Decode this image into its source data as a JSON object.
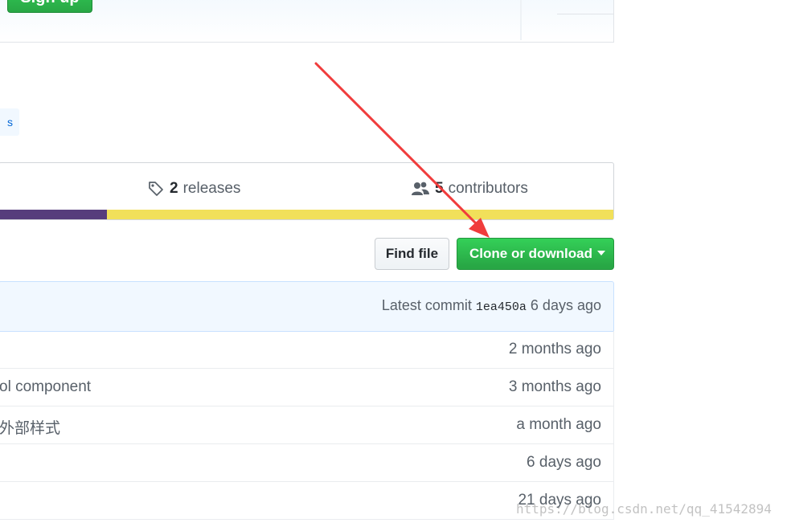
{
  "signup": {
    "button_label": "Sign up"
  },
  "topic": {
    "label": "s"
  },
  "summary": {
    "releases_count": "2",
    "releases_label": "releases",
    "contributors_count": "5",
    "contributors_label": "contributors",
    "language_bar": [
      {
        "color": "#563d7c",
        "share": 0.175
      },
      {
        "color": "#f1e05a",
        "share": 0.825
      }
    ]
  },
  "file_nav": {
    "find_file_label": "Find file",
    "clone_label": "Clone or download"
  },
  "commit_tease": {
    "prefix": "Latest commit",
    "sha": "1ea450a",
    "age": "6 days ago"
  },
  "files": [
    {
      "message": "",
      "age": "2 months ago"
    },
    {
      "message": "ol component",
      "age": "3 months ago"
    },
    {
      "message": "外部样式",
      "age": "a month ago"
    },
    {
      "message": "",
      "age": "6 days ago"
    },
    {
      "message": "",
      "age": "21 days ago"
    }
  ],
  "annotation": {
    "color": "#f03c3c"
  },
  "watermark": "https://blog.csdn.net/qq_41542894",
  "colors": {
    "accent_green": "#28a745",
    "link_blue": "#0366d6",
    "commit_bg": "#f1f8ff"
  }
}
